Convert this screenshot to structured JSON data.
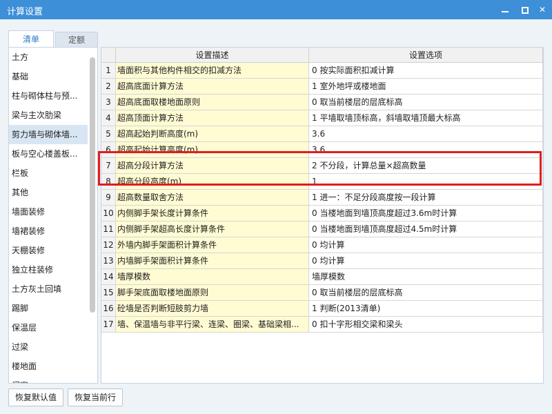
{
  "window": {
    "title": "计算设置",
    "minimize": "—",
    "maximize": "□",
    "close": "✕"
  },
  "tabs": [
    {
      "label": "清单",
      "active": true
    },
    {
      "label": "定额",
      "active": false
    }
  ],
  "categories": [
    "土方",
    "基础",
    "柱与砌体柱与预...",
    "梁与主次肋梁",
    "剪力墙与砌体墙...",
    "板与空心楼盖板...",
    "栏板",
    "其他",
    "墙面装修",
    "墙裙装修",
    "天棚装修",
    "独立柱装修",
    "土方灰土回填",
    "踢脚",
    "保温层",
    "过梁",
    "楼地面",
    "门窗"
  ],
  "selected_category": "剪力墙与砌体墙...",
  "table": {
    "headers": {
      "desc": "设置描述",
      "option": "设置选项"
    },
    "rows": [
      {
        "n": "1",
        "desc": "墙面积与其他构件相交的扣减方法",
        "option": "0 按实际面积扣减计算"
      },
      {
        "n": "2",
        "desc": "超高底面计算方法",
        "option": "1 室外地坪或楼地面"
      },
      {
        "n": "3",
        "desc": "超高底面取楼地面原则",
        "option": "0 取当前楼层的层底标高"
      },
      {
        "n": "4",
        "desc": "超高顶面计算方法",
        "option": "1 平墙取墙顶标高，斜墙取墙顶最大标高"
      },
      {
        "n": "5",
        "desc": "超高起始判断高度(m)",
        "option": "3.6"
      },
      {
        "n": "6",
        "desc": "超高起始计算高度(m)",
        "option": "3.6"
      },
      {
        "n": "7",
        "desc": "超高分段计算方法",
        "option": "2 不分段，计算总量×超高数量"
      },
      {
        "n": "8",
        "desc": "超高分段高度(m)",
        "option": "1"
      },
      {
        "n": "9",
        "desc": "超高数量取舍方法",
        "option": "1 进一：不足分段高度按一段计算"
      },
      {
        "n": "10",
        "desc": "内侧脚手架长度计算条件",
        "option": "0 当楼地面到墙顶高度超过3.6m时计算"
      },
      {
        "n": "11",
        "desc": "内侧脚手架超高长度计算条件",
        "option": "0 当楼地面到墙顶高度超过4.5m时计算"
      },
      {
        "n": "12",
        "desc": "外墙内脚手架面积计算条件",
        "option": "0 均计算"
      },
      {
        "n": "13",
        "desc": "内墙脚手架面积计算条件",
        "option": "0 均计算"
      },
      {
        "n": "14",
        "desc": "墙厚模数",
        "option": "墙厚模数"
      },
      {
        "n": "15",
        "desc": "脚手架底面取楼地面原则",
        "option": "0 取当前楼层的层底标高"
      },
      {
        "n": "16",
        "desc": "砼墙是否判断短肢剪力墙",
        "option": "1 判断(2013清单)"
      },
      {
        "n": "17",
        "desc": "墙、保温墙与非平行梁、连梁、圈梁、基础梁相...",
        "option": "0 扣十字形相交梁和梁头"
      }
    ]
  },
  "highlight_rows": [
    "7",
    "8"
  ],
  "buttons": {
    "reset_default": "恢复默认值",
    "reset_current": "恢复当前行"
  },
  "colors": {
    "titlebar": "#3d8fd8",
    "desc_cell_bg": "#fffbd3",
    "highlight_border": "#e21c1c",
    "selected_item_bg": "#d8e6f4"
  }
}
